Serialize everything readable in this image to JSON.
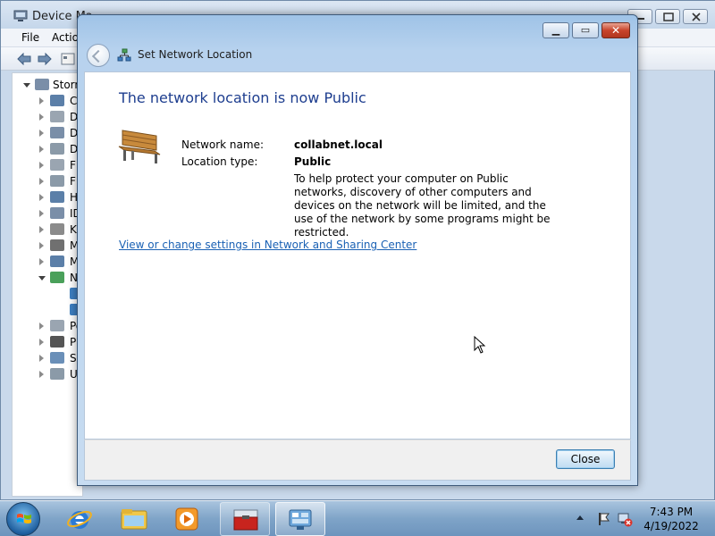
{
  "background_window": {
    "title": "Device Ma",
    "menu": [
      "File",
      "Actio"
    ],
    "tree_root": "Storm",
    "tree_items": [
      "C",
      "D",
      "D",
      "D",
      "Fl",
      "Fl",
      "H",
      "ID",
      "K",
      "M",
      "M",
      "N",
      "",
      "",
      "Po",
      "Pr",
      "Sy",
      "U"
    ]
  },
  "dialog": {
    "header_title": "Set Network Location",
    "main_title": "The network location is now Public",
    "network_name_label": "Network name:",
    "network_name_value": "collabnet.local",
    "location_type_label": "Location type:",
    "location_type_value": "Public",
    "description": "To help protect your computer on Public networks, discovery of other computers and devices on the network will be limited, and the use of the network by some programs might be restricted.",
    "link": "View or change settings in Network and Sharing Center",
    "close_label": "Close"
  },
  "taskbar": {
    "time": "7:43 PM",
    "date": "4/19/2022"
  },
  "colors": {
    "title_blue": "#1e3e8f",
    "link_blue": "#1a61b4",
    "close_red": "#c8442c"
  }
}
